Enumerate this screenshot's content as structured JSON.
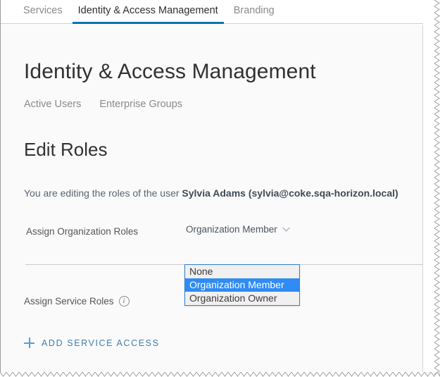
{
  "top_tabs": [
    {
      "label": "Services",
      "active": false
    },
    {
      "label": "Identity & Access Management",
      "active": true
    },
    {
      "label": "Branding",
      "active": false
    }
  ],
  "page": {
    "title": "Identity & Access Management",
    "subtabs": [
      {
        "label": "Active Users"
      },
      {
        "label": "Enterprise Groups"
      }
    ],
    "section_title": "Edit Roles",
    "description_prefix": "You are editing the roles of the user ",
    "description_user": "Sylvia Adams (sylvia@coke.sqa-horizon.local)"
  },
  "org_roles": {
    "label": "Assign Organization Roles",
    "selected_value": "Organization Member",
    "chevron_icon": "chevron-down-icon",
    "expanded": true,
    "options": [
      {
        "label": "None",
        "selected": false
      },
      {
        "label": "Organization Member",
        "selected": true
      },
      {
        "label": "Organization Owner",
        "selected": false
      }
    ]
  },
  "service_roles": {
    "label": "Assign Service Roles",
    "info_icon": "info-icon",
    "info_glyph": "i",
    "add_button": {
      "label": "ADD SERVICE ACCESS",
      "icon": "plus-icon"
    }
  },
  "colors": {
    "accent_blue": "#0a74ad",
    "link_blue": "#3f7fae",
    "selection_blue": "#2f8bf5",
    "dropdown_border": "#2f7fd0",
    "panel_bg": "#fafafa",
    "text_dark": "#313131",
    "text_muted": "#8a8a8a"
  }
}
